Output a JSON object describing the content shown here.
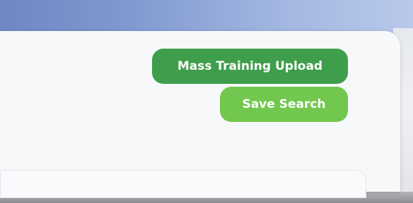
{
  "toolbar": {
    "mass_training_upload_label": "Mass Training Upload",
    "save_search_label": "Save Search"
  },
  "colors": {
    "primary_green": "#3e9e4c",
    "light_green": "#72c84f",
    "header_blue": "#7f98cf",
    "card_background": "#f7f8f9"
  }
}
